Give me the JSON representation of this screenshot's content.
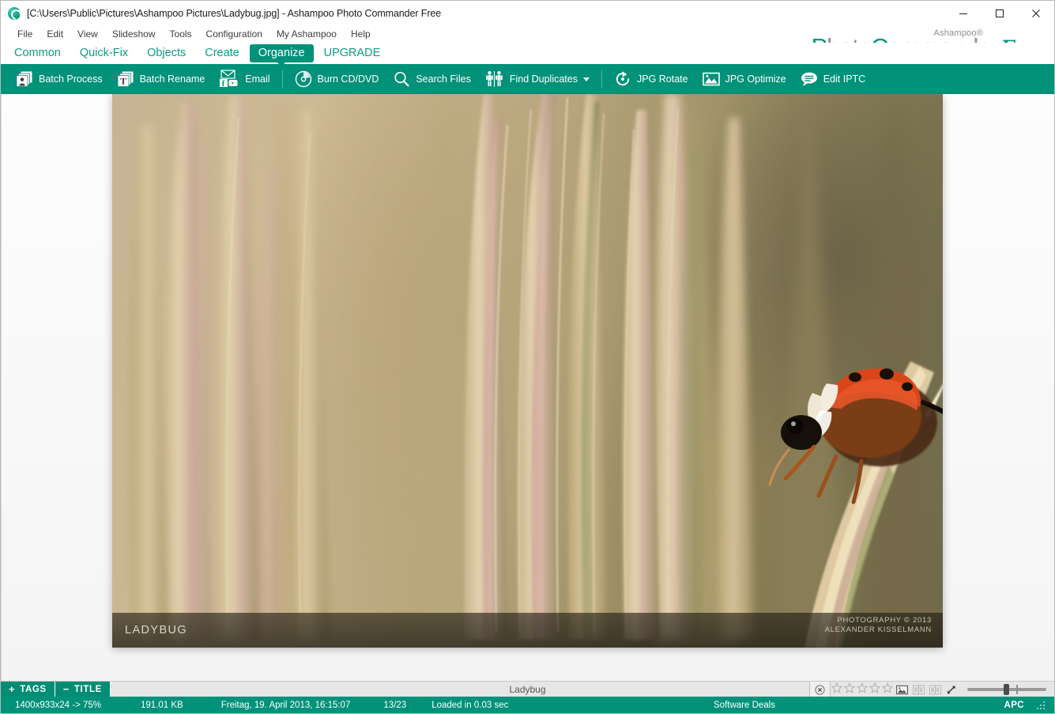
{
  "window": {
    "title": "[C:\\Users\\Public\\Pictures\\Ashampoo Pictures\\Ladybug.jpg] - Ashampoo Photo Commander Free",
    "app_icon": "ashampoo-circle-icon",
    "minimize": "—",
    "maximize": "□",
    "close": "✕"
  },
  "menubar": {
    "items": [
      {
        "label": "File"
      },
      {
        "label": "Edit"
      },
      {
        "label": "View"
      },
      {
        "label": "Slideshow"
      },
      {
        "label": "Tools"
      },
      {
        "label": "Configuration"
      },
      {
        "label": "My Ashampoo"
      },
      {
        "label": "Help"
      }
    ]
  },
  "logo": {
    "superscript": "Ashampoo®",
    "photo": "P",
    "name_rest_1": "hoto",
    "commander_c": "C",
    "name_rest_2": "ommander",
    "free": "Free"
  },
  "ribbon_tabs": {
    "items": [
      {
        "label": "Common",
        "active": false
      },
      {
        "label": "Quick-Fix",
        "active": false
      },
      {
        "label": "Objects",
        "active": false
      },
      {
        "label": "Create",
        "active": false
      },
      {
        "label": "Organize",
        "active": true
      },
      {
        "label": "UPGRADE",
        "active": false
      }
    ]
  },
  "toolbar": {
    "items": [
      {
        "label": "Batch Process",
        "icon": "batch-process-icon"
      },
      {
        "label": "Batch Rename",
        "icon": "batch-rename-icon"
      },
      {
        "label": "Email",
        "icon": "email-social-icon"
      },
      {
        "label": "Burn CD/DVD",
        "icon": "disc-icon"
      },
      {
        "label": "Search Files",
        "icon": "magnifier-icon"
      },
      {
        "label": "Find Duplicates",
        "icon": "duplicates-icon",
        "has_caret": true
      },
      {
        "label": "JPG Rotate",
        "icon": "rotate-icon"
      },
      {
        "label": "JPG Optimize",
        "icon": "image-optimize-icon"
      },
      {
        "label": "Edit IPTC",
        "icon": "speech-bubble-icon"
      }
    ]
  },
  "photo": {
    "caption": "LADYBUG",
    "credit_line1": "PHOTOGRAPHY © 2013",
    "credit_line2": "ALEXANDER KISSELMANN"
  },
  "tags_bar": {
    "tags_button": {
      "sign": "+",
      "label": "TAGS"
    },
    "title_button": {
      "sign": "−",
      "label": "TITLE"
    },
    "center_title": "Ladybug",
    "close_icon": "close-circle-icon",
    "rating_stars": 5,
    "rating_value": 0,
    "tool_icons": [
      "image-preview-icon",
      "compare-left-icon",
      "compare-right-icon",
      "fullscreen-arrows-icon"
    ],
    "zoom_slider": {
      "value": 46,
      "max": 100
    }
  },
  "statusbar": {
    "dimensions": "1400x933x24 -> 75%",
    "filesize": "191.01 KB",
    "date": "Freitag, 19. April 2013, 16:15:07",
    "index": "13/23",
    "loaded": "Loaded in 0.03 sec",
    "deals": "Software Deals",
    "brand": "APC"
  },
  "colors": {
    "teal": "#029179",
    "teal_dark": "#008d74",
    "tab_text": "#0d9c83",
    "logo_gray": "#8d8d8d"
  }
}
